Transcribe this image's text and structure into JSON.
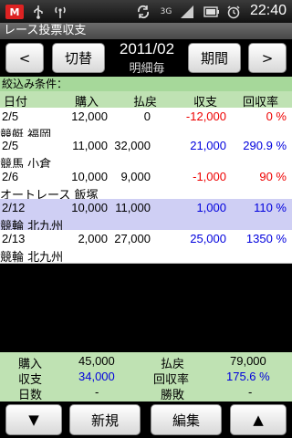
{
  "status": {
    "gmail_icon": "gmail-icon",
    "usb_icon": "usb-icon",
    "antenna_icon": "antenna-icon",
    "sync_icon": "sync-icon",
    "net_label": "3G",
    "signal_icon": "signal-icon",
    "battery_icon": "battery-icon",
    "alarm_icon": "alarm-icon",
    "time": "22:40"
  },
  "app": {
    "title": "レース投票収支"
  },
  "nav": {
    "prev": "<",
    "switch": "切替",
    "period_title": "2011/02",
    "period_sub": "明細毎",
    "period_button": "期間",
    "next": ">"
  },
  "filter": {
    "label": "絞込み条件："
  },
  "table": {
    "headers": [
      "日付",
      "購入",
      "払戻",
      "収支",
      "回収率"
    ],
    "rows": [
      {
        "date": "2/5",
        "buy": "12,000",
        "pay": "0",
        "balance": "-12,000",
        "rate": "0 %",
        "place": "競艇 福岡"
      },
      {
        "date": "2/5",
        "buy": "11,000",
        "pay": "32,000",
        "balance": "21,000",
        "rate": "290.9 %",
        "place": "競馬 小倉"
      },
      {
        "date": "2/6",
        "buy": "10,000",
        "pay": "9,000",
        "balance": "-1,000",
        "rate": "90 %",
        "place": "オートレース 飯塚"
      },
      {
        "date": "2/12",
        "buy": "10,000",
        "pay": "11,000",
        "balance": "1,000",
        "rate": "110 %",
        "place": "競輪 北九州"
      },
      {
        "date": "2/13",
        "buy": "2,000",
        "pay": "27,000",
        "balance": "25,000",
        "rate": "1350 %",
        "place": "競輪 北九州"
      }
    ]
  },
  "summary": {
    "buy_label": "購入",
    "buy_value": "45,000",
    "pay_label": "払戻",
    "pay_value": "79,000",
    "bal_label": "収支",
    "bal_value": "34,000",
    "rate_label": "回収率",
    "rate_value": "175.6 %",
    "days_label": "日数",
    "days_value": "-",
    "winloss_label": "勝敗",
    "winloss_value": "-"
  },
  "bottom": {
    "down": "▼",
    "new": "新規",
    "edit": "編集",
    "up": "▲"
  },
  "colors": {
    "header_green": "#bfe2b3",
    "filter_green": "#a6d89a",
    "highlight_row": "#cfcff4",
    "negative": "#e00000",
    "positive": "#0000dd"
  }
}
